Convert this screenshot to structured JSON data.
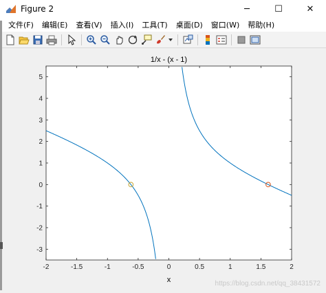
{
  "window": {
    "title": "Figure 2",
    "minimize_icon": "minimize-icon",
    "maximize_icon": "maximize-icon",
    "close_icon": "close-icon",
    "controls": {
      "minimize": "─",
      "maximize": "☐",
      "close": "✕"
    }
  },
  "menu": {
    "items": [
      {
        "label": "文件(F)"
      },
      {
        "label": "编辑(E)"
      },
      {
        "label": "查看(V)"
      },
      {
        "label": "插入(I)"
      },
      {
        "label": "工具(T)"
      },
      {
        "label": "桌面(D)"
      },
      {
        "label": "窗口(W)"
      },
      {
        "label": "帮助(H)"
      }
    ]
  },
  "toolbar": {
    "buttons": [
      "new-figure-icon",
      "open-file-icon",
      "save-icon",
      "print-icon",
      "pointer-icon",
      "zoom-in-icon",
      "zoom-out-icon",
      "pan-icon",
      "rotate-3d-icon",
      "data-cursor-icon",
      "brush-icon",
      "link-plot-icon",
      "colorbar-icon",
      "legend-icon",
      "hide-plot-tools-icon",
      "show-plot-tools-icon"
    ]
  },
  "colors": {
    "curve": "#0072bd",
    "marker_left": "#c8a632",
    "marker_right": "#d9541a",
    "axes_bg": "#ffffff",
    "figure_bg": "#f0f0f0"
  },
  "watermark": "https://blog.csdn.net/qq_38431572",
  "chart_data": {
    "type": "line",
    "title": "1/x - (x - 1)",
    "xlabel": "x",
    "ylabel": "",
    "xlim": [
      -2,
      2
    ],
    "ylim": [
      -3.5,
      5.5
    ],
    "xticks": [
      -2,
      -1.5,
      -1,
      -0.5,
      0,
      0.5,
      1,
      1.5,
      2
    ],
    "xtick_labels": [
      "-2",
      "-1.5",
      "-1",
      "-0.5",
      "0",
      "0.5",
      "1",
      "1.5",
      "2"
    ],
    "yticks": [
      -3,
      -2,
      -1,
      0,
      1,
      2,
      3,
      4,
      5
    ],
    "ytick_labels": [
      "-3",
      "-2",
      "-1",
      "0",
      "1",
      "2",
      "3",
      "4",
      "5"
    ],
    "grid": false,
    "series": [
      {
        "function": "1/x - (x - 1)"
      }
    ],
    "markers": [
      {
        "x": -0.618,
        "y": 0
      },
      {
        "x": 1.618,
        "y": 0
      }
    ]
  }
}
